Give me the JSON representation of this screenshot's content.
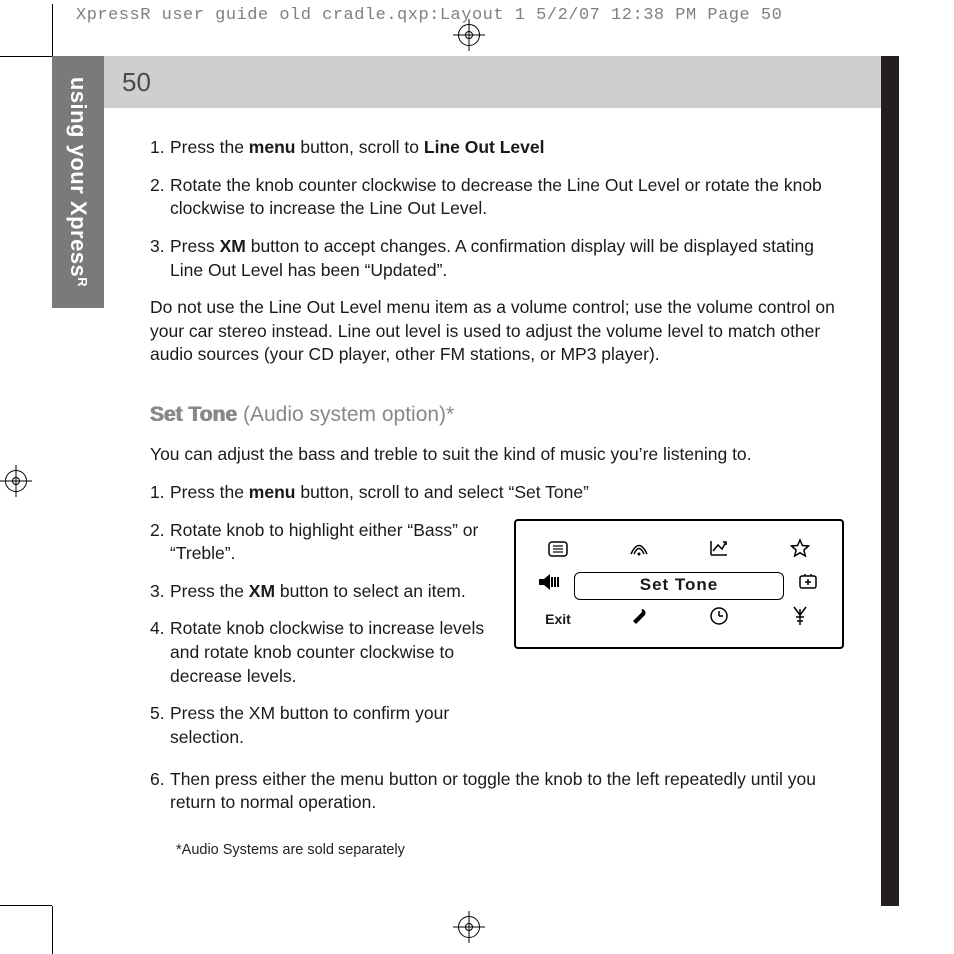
{
  "prepress": {
    "header": "XpressR user guide old cradle.qxp:Layout 1  5/2/07  12:38 PM  Page 50"
  },
  "sidebar": {
    "label_main": "using your Xpress",
    "label_sup": "R"
  },
  "page_number": "50",
  "steps_top": [
    {
      "num": "1.",
      "pre": "Press the ",
      "b1": "menu",
      "mid": " button, scroll to ",
      "b2": "Line Out Level",
      "post": ""
    },
    {
      "num": "2.",
      "text": "Rotate the knob counter clockwise to decrease the Line Out Level or rotate the knob clockwise to increase the Line Out Level."
    },
    {
      "num": "3.",
      "pre": "Press ",
      "b1": "XM",
      "post": " button to accept changes.  A confirmation display will be displayed stating Line Out Level has been “Updated”."
    }
  ],
  "note": "Do not use the Line Out Level menu item as a volume control; use the volume control on your car stereo instead.  Line out level is used to adjust the volume level to match other audio sources (your CD player, other FM stations, or MP3 player).",
  "section": {
    "lead": "Set Tone",
    "rest": " (Audio system option)*"
  },
  "intro": "You can adjust the bass and treble to suit the kind of music you’re listening to.",
  "steps_bottom": [
    {
      "num": "1.",
      "pre": "Press the ",
      "b1": "menu",
      "post": " button, scroll to and select “Set Tone”"
    },
    {
      "num": "2.",
      "text": "Rotate knob to highlight either “Bass” or “Treble”."
    },
    {
      "num": "3.",
      "pre": "Press the ",
      "b1": "XM",
      "post": " button to select an item."
    },
    {
      "num": "4.",
      "text": "Rotate knob clockwise to increase levels and rotate knob counter clockwise to decrease levels."
    },
    {
      "num": "5.",
      "text": "Press the XM button to confirm your selection."
    },
    {
      "num": "6.",
      "text": "Then press either the menu button or toggle the knob to the left repeatedly until you return to normal operation."
    }
  ],
  "screen": {
    "title": "Set  Tone",
    "exit": "Exit"
  },
  "footnote": "*Audio Systems are sold separately"
}
